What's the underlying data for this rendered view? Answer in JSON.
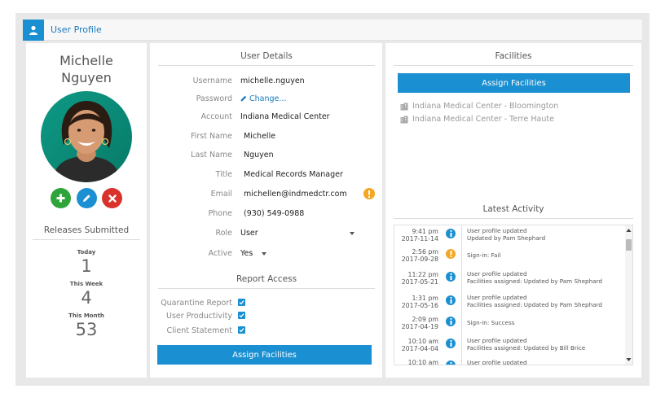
{
  "header": {
    "title": "User Profile",
    "icon": "user-icon"
  },
  "profile": {
    "first_line": "Michelle",
    "second_line": "Nguyen",
    "actions": [
      "add-icon",
      "edit-icon",
      "delete-icon"
    ]
  },
  "releases": {
    "title": "Releases Submitted",
    "stats": [
      {
        "label": "Today",
        "value": "1"
      },
      {
        "label": "This Week",
        "value": "4"
      },
      {
        "label": "This Month",
        "value": "53"
      }
    ]
  },
  "details": {
    "title": "User Details",
    "username": {
      "label": "Username",
      "value": "michelle.nguyen"
    },
    "password": {
      "label": "Password",
      "value": "Change..."
    },
    "account": {
      "label": "Account",
      "value": "Indiana Medical Center"
    },
    "first_name": {
      "label": "First Name",
      "value": "Michelle"
    },
    "last_name": {
      "label": "Last Name",
      "value": "Nguyen"
    },
    "title_field": {
      "label": "Title",
      "value": "Medical Records Manager"
    },
    "email": {
      "label": "Email",
      "value": "michellen@indmedctr.com"
    },
    "phone": {
      "label": "Phone",
      "value": "(930) 549-0988"
    },
    "role": {
      "label": "Role",
      "value": "User"
    },
    "active": {
      "label": "Active",
      "value": "Yes"
    }
  },
  "report_access": {
    "title": "Report Access",
    "items": [
      {
        "label": "Quarantine Report",
        "checked": true
      },
      {
        "label": "User Productivity",
        "checked": true
      },
      {
        "label": "Client Statement",
        "checked": true
      }
    ],
    "button": "Assign Facilities"
  },
  "facilities": {
    "title": "Facilities",
    "button": "Assign Facilities",
    "items": [
      "Indiana Medical Center - Bloomington",
      "Indiana Medical Center - Terre Haute"
    ]
  },
  "activity": {
    "title": "Latest Activity",
    "items": [
      {
        "time": "9:41 pm",
        "date": "2017-11-14",
        "kind": "info",
        "line1": "User profile updated",
        "line2": "Updated by Pam Shephard"
      },
      {
        "time": "2:56 pm",
        "date": "2017-09-28",
        "kind": "warning",
        "line1": "Sign-in: Fail",
        "line2": ""
      },
      {
        "time": "11:22 pm",
        "date": "2017-05-21",
        "kind": "info",
        "line1": "User profile updated",
        "line2": "Facilities assigned: Updated by Pam Shephard"
      },
      {
        "time": "1:31 pm",
        "date": "2017-05-16",
        "kind": "info",
        "line1": "User profile updated",
        "line2": "Facilities assigned: Updated by Pam Shephard"
      },
      {
        "time": "2:09 pm",
        "date": "2017-04-19",
        "kind": "info",
        "line1": "Sign-in: Success",
        "line2": ""
      },
      {
        "time": "10:10 am",
        "date": "2017-04-04",
        "kind": "info",
        "line1": "User profile updated",
        "line2": "Facilities assigned: Updated by Bill Brice"
      },
      {
        "time": "10:10 am",
        "date": "",
        "kind": "info",
        "line1": "User profile updated",
        "line2": ""
      }
    ]
  },
  "colors": {
    "accent": "#1a8fd1",
    "warning": "#f5a623",
    "add": "#2ea43b",
    "delete": "#d9322c"
  }
}
